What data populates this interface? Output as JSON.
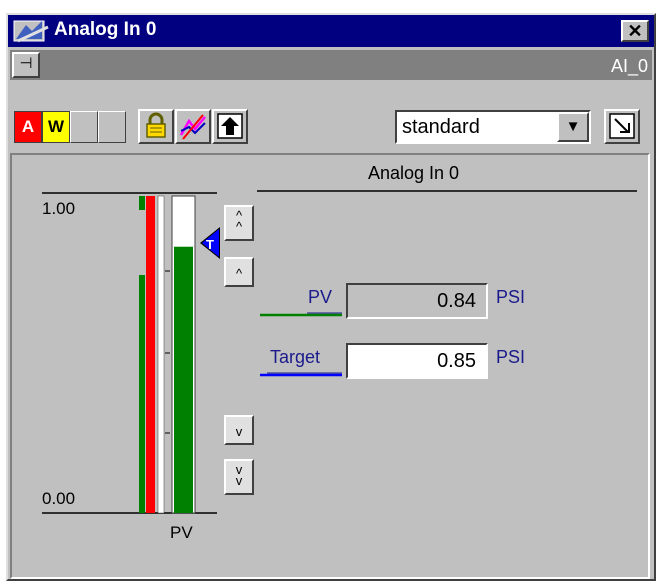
{
  "window": {
    "title": "Analog In 0",
    "close_glyph": "✕",
    "icon": "faceplate-app-icon"
  },
  "tagbar": {
    "tag": "AI_0",
    "pin_icon": "pin-icon"
  },
  "toolbar": {
    "alarm_indicator": "A",
    "warning_indicator": "W",
    "buttons": [
      "lock-icon",
      "trend-icon",
      "up-arrow-icon"
    ],
    "mode": "standard",
    "expand_icon": "expand-icon"
  },
  "faceplate": {
    "header": "Analog In 0",
    "scale_high": "1.00",
    "scale_low": "0.00",
    "bar_label": "PV",
    "target_marker": "T",
    "pv_fill_fraction": 0.84,
    "setpoint_buttons": [
      "double-up-icon",
      "up-icon",
      "down-icon",
      "double-down-icon"
    ],
    "pv": {
      "label": "PV",
      "value": "0.84",
      "unit": "PSI"
    },
    "target": {
      "label": "Target",
      "value": "0.85",
      "unit": "PSI"
    }
  },
  "colors": {
    "title_bar": "#000080",
    "alarm": "#ff0000",
    "warning": "#ffff00",
    "pv_bar": "#008000",
    "target": "#0000ff",
    "label_text": "#1a1a8c"
  }
}
